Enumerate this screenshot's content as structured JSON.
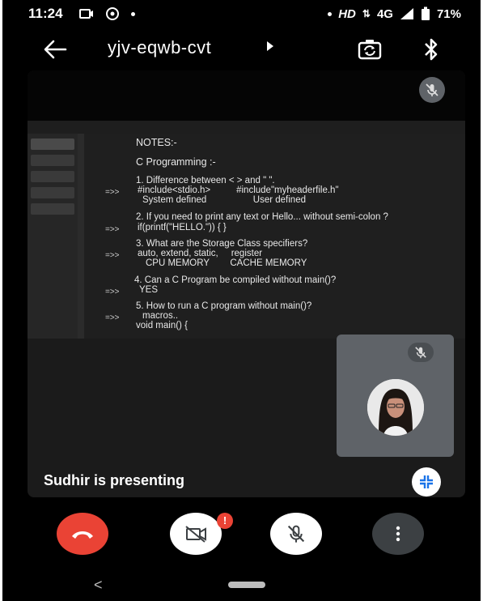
{
  "status_bar": {
    "time": "11:24",
    "hd_label": "HD",
    "network": "4G",
    "battery": "71%"
  },
  "header": {
    "meeting_code": "yjv-eqwb-cvt",
    "icons": [
      "back-arrow-icon",
      "dropdown-arrow-icon",
      "camera-switch-icon",
      "bluetooth-icon"
    ]
  },
  "shared_screen": {
    "lines": [
      "NOTES:-",
      "C Programming :-",
      "1. Difference between < > and \" \".",
      "#include<stdio.h>          #include\"myheaderfile.h\"",
      "System defined                  User defined",
      "2. If you need to print any text or Hello... without semi-colon ?",
      "if(printf(\"HELLO.\")) { }",
      "3. What are the Storage Class specifiers?",
      "auto, extend, static,     register",
      "CPU MEMORY        CACHE MEMORY",
      "4. Can a C Program be compiled without main()?",
      "YES",
      "5. How to run a C program without main()?",
      "macros..",
      "void main() {"
    ],
    "arrow": "=>>"
  },
  "presenter": {
    "text": "Sudhir is presenting"
  },
  "controls": {
    "badge": "!",
    "icons": [
      "end-call-icon",
      "video-off-icon",
      "mic-off-icon",
      "more-options-icon"
    ]
  },
  "nav": {
    "back": "<"
  },
  "colors": {
    "end_call": "#ea4335",
    "tile": "#5f6368",
    "stage": "#1b1b1b"
  }
}
